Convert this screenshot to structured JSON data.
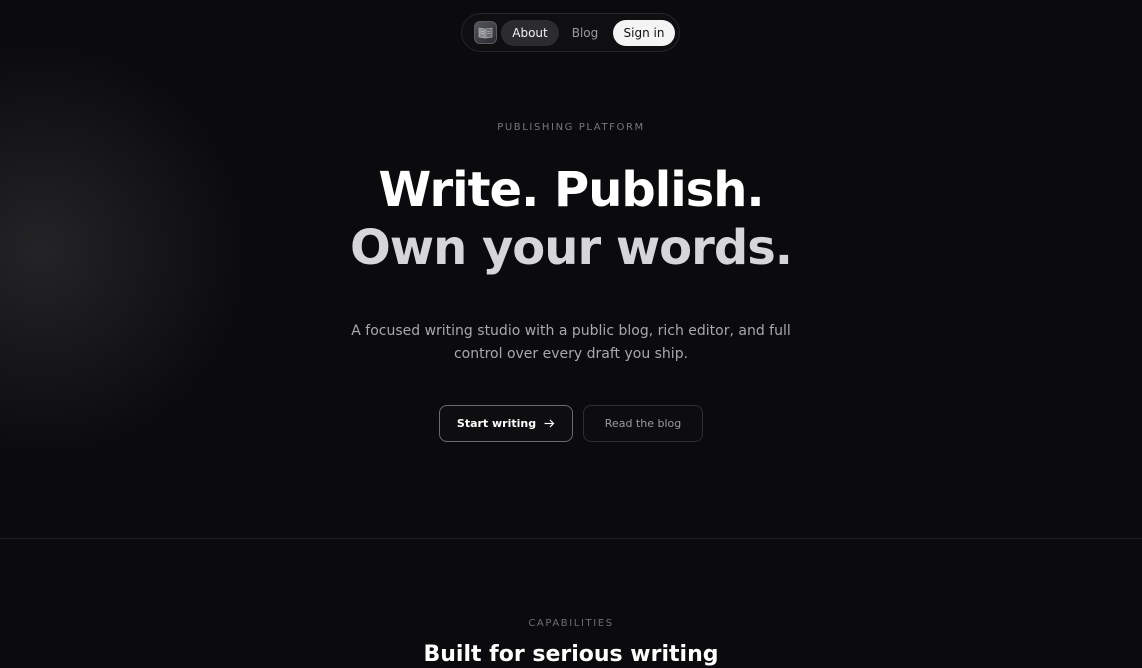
{
  "nav": {
    "logo_icon": "book-icon",
    "about_label": "About",
    "blog_label": "Blog",
    "signin_label": "Sign in"
  },
  "hero": {
    "eyebrow": "PUBLISHING PLATFORM",
    "headline_line1": "Write. Publish.",
    "headline_line2": "Own your words.",
    "subtitle": "A focused writing studio with a public blog, rich editor, and full control over every draft you ship.",
    "primary_cta": "Start writing",
    "primary_cta_icon": "arrow-right-icon",
    "secondary_cta": "Read the blog"
  },
  "capabilities": {
    "eyebrow": "CAPABILITIES",
    "title": "Built for serious writing"
  },
  "colors": {
    "background": "#0b0b0d",
    "text_primary": "#ffffff",
    "text_muted": "#a8a8ae",
    "signin_bg": "#f4f4f4"
  }
}
